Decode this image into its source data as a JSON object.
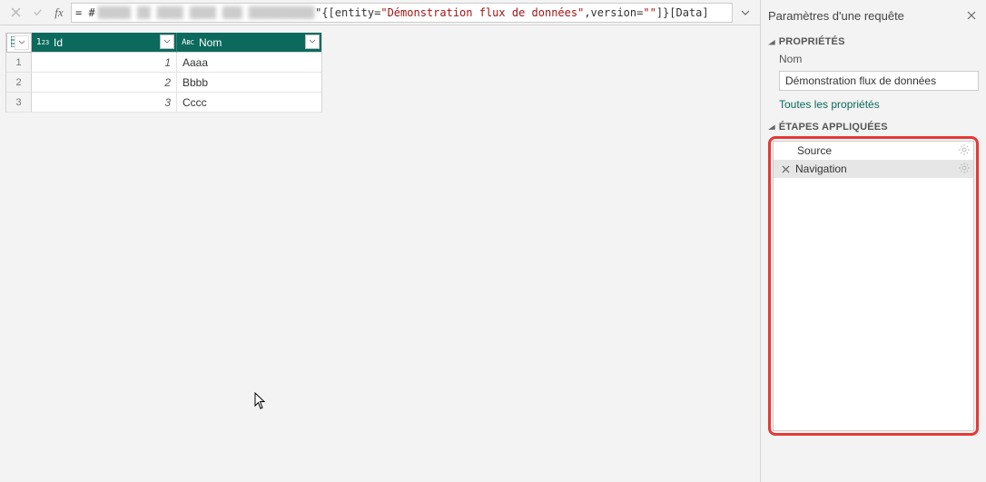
{
  "formula": {
    "prefix": "= #",
    "obscured": "█████ ██ ████ ████ ███ ██████████",
    "part1": "\"{[entity=",
    "string1": "\"Démonstration flux de données\"",
    "part2": ",version=",
    "string2": "\"\"",
    "part3": "]}[Data]"
  },
  "grid": {
    "columns": [
      {
        "name": "Id",
        "type": "int"
      },
      {
        "name": "Nom",
        "type": "text"
      }
    ],
    "rows": [
      {
        "n": "1",
        "id": "1",
        "nom": "Aaaa"
      },
      {
        "n": "2",
        "id": "2",
        "nom": "Bbbb"
      },
      {
        "n": "3",
        "id": "3",
        "nom": "Cccc"
      }
    ]
  },
  "side": {
    "title": "Paramètres d'une requête",
    "properties_label": "PROPRIÉTÉS",
    "name_label": "Nom",
    "name_value": "Démonstration flux de données",
    "all_props": "Toutes les propriétés",
    "steps_label": "ÉTAPES APPLIQUÉES",
    "steps": [
      {
        "label": "Source",
        "selected": false,
        "gear": true
      },
      {
        "label": "Navigation",
        "selected": true,
        "gear": true
      }
    ]
  }
}
